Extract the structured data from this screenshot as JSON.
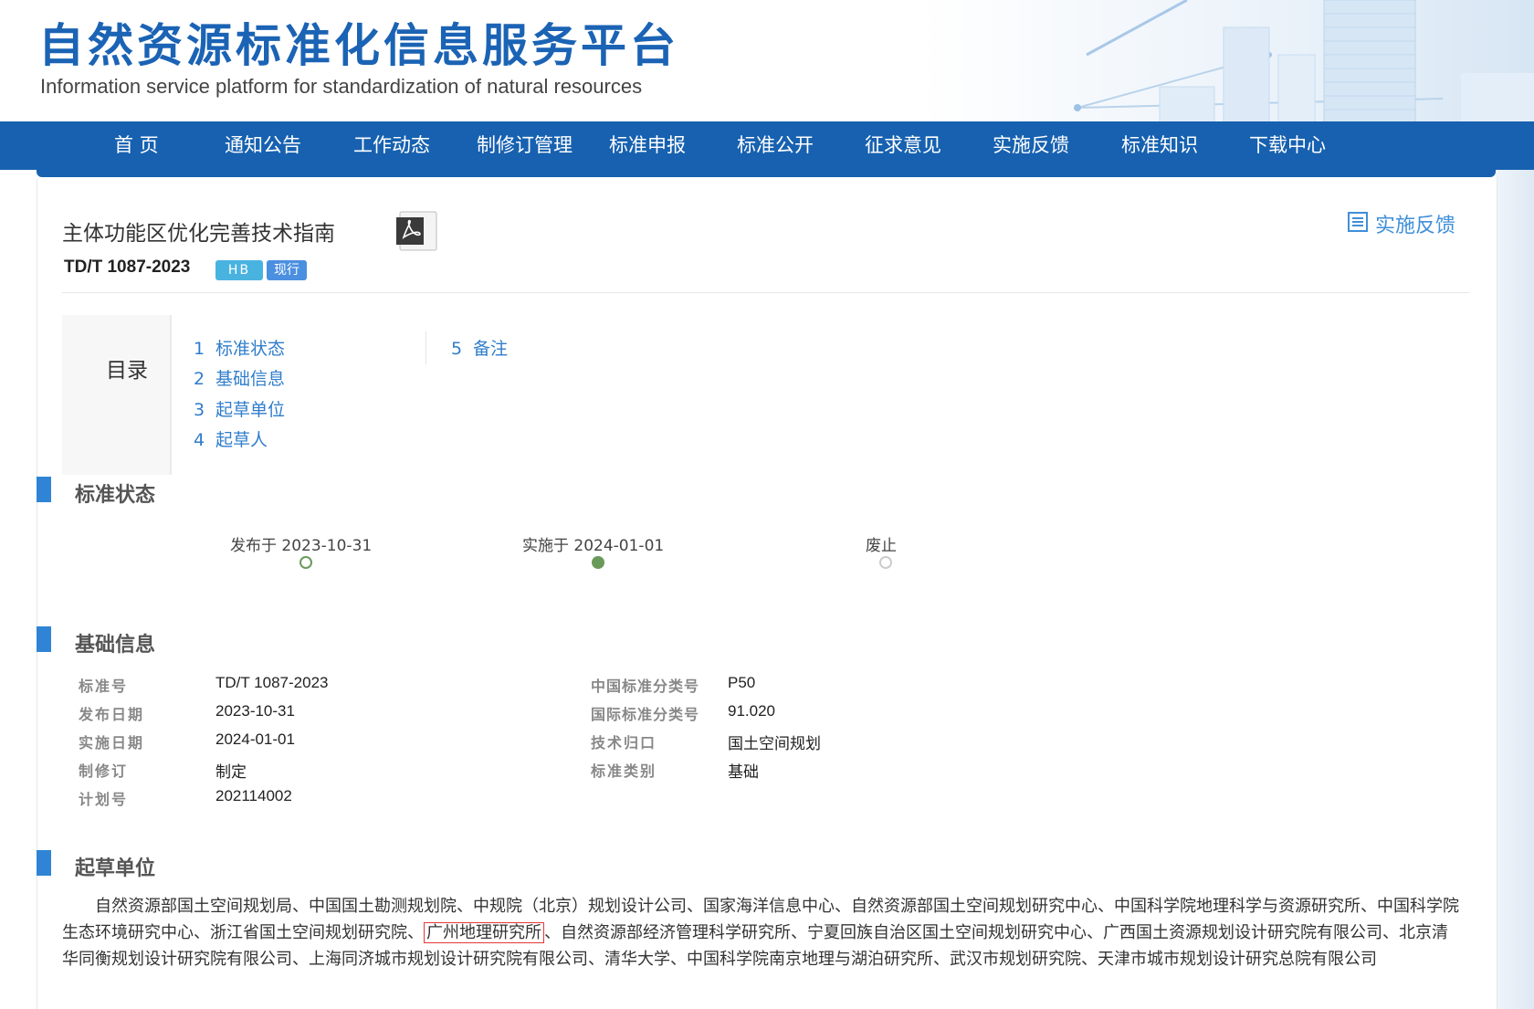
{
  "header": {
    "title": "自然资源标准化信息服务平台",
    "subtitle": "Information service platform for standardization of natural resources"
  },
  "nav": {
    "items": [
      "首 页",
      "通知公告",
      "工作动态",
      "制修订管理",
      "标准申报",
      "标准公开",
      "征求意见",
      "实施反馈",
      "标准知识",
      "下载中心"
    ]
  },
  "document": {
    "title": "主体功能区优化完善技术指南",
    "code": "TD/T 1087-2023",
    "badge_type": "HB",
    "badge_status": "现行",
    "feedback_label": "实施反馈",
    "pdf_icon": "pdf-icon"
  },
  "toc": {
    "label": "目录",
    "items": [
      {
        "num": "1",
        "label": "标准状态"
      },
      {
        "num": "2",
        "label": "基础信息"
      },
      {
        "num": "3",
        "label": "起草单位"
      },
      {
        "num": "4",
        "label": "起草人"
      },
      {
        "num": "5",
        "label": "备注"
      }
    ]
  },
  "status_section": {
    "title": "标准状态",
    "timeline": [
      {
        "label": "发布于 2023-10-31",
        "state": "done"
      },
      {
        "label": "实施于 2024-01-01",
        "state": "current"
      },
      {
        "label": "废止",
        "state": "pending"
      }
    ],
    "colors": {
      "done": "#6a9a5a",
      "pending": "#cccccc"
    }
  },
  "basic_section": {
    "title": "基础信息",
    "left": [
      {
        "label": "标准号",
        "value": "TD/T 1087-2023"
      },
      {
        "label": "发布日期",
        "value": "2023-10-31"
      },
      {
        "label": "实施日期",
        "value": "2024-01-01"
      },
      {
        "label": "制修订",
        "value": "制定"
      },
      {
        "label": "计划号",
        "value": "202114002"
      }
    ],
    "right": [
      {
        "label": "中国标准分类号",
        "value": "P50"
      },
      {
        "label": "国际标准分类号",
        "value": "91.020"
      },
      {
        "label": "技术归口",
        "value": "国土空间规划"
      },
      {
        "label": "标准类别",
        "value": "基础"
      }
    ]
  },
  "drafting_section": {
    "title": "起草单位",
    "text_before": "自然资源部国土空间规划局、中国国土勘测规划院、中规院（北京）规划设计公司、国家海洋信息中心、自然资源部国土空间规划研究中心、中国科学院地理科学与资源研究所、中国科学院生态环境研究中心、浙江省国土空间规划研究院、",
    "highlighted": "广州地理研究所",
    "text_after": "、自然资源部经济管理科学研究所、宁夏回族自治区国土空间规划研究中心、广西国土资源规划设计研究院有限公司、北京清华同衡规划设计研究院有限公司、上海同济城市规划设计研究院有限公司、清华大学、中国科学院南京地理与湖泊研究所、武汉市规划研究院、天津市城市规划设计研究总院有限公司"
  },
  "colors": {
    "brand_blue": "#1761b0",
    "title_blue": "#1b63b4",
    "link_blue": "#2f7dcc",
    "section_bar": "#2f84d6",
    "highlight_border": "#e53935"
  }
}
